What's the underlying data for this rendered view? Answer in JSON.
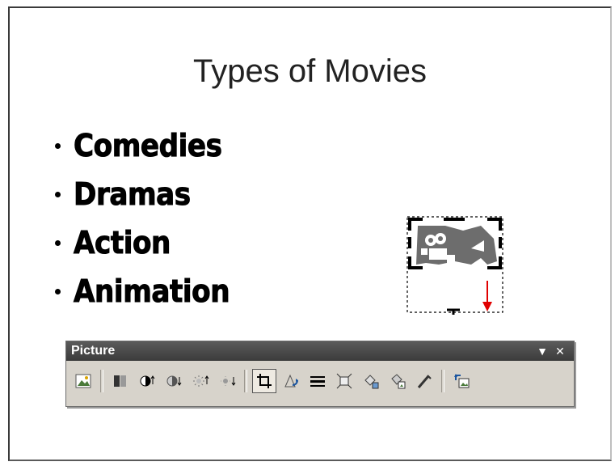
{
  "slide": {
    "title": "Types of Movies",
    "bullets": [
      "Comedies",
      "Dramas",
      "Action",
      "Animation"
    ]
  },
  "clip_art": {
    "icon": "movie-camera-clipart",
    "selected": true
  },
  "toolbar": {
    "title": "Picture",
    "menu_glyph": "▼",
    "close_glyph": "✕",
    "buttons": [
      {
        "name": "insert-picture",
        "icon": "insert-picture-icon"
      },
      {
        "name": "color",
        "icon": "color-icon"
      },
      {
        "name": "more-contrast",
        "icon": "more-contrast-icon"
      },
      {
        "name": "less-contrast",
        "icon": "less-contrast-icon"
      },
      {
        "name": "more-brightness",
        "icon": "more-brightness-icon"
      },
      {
        "name": "less-brightness",
        "icon": "less-brightness-icon"
      },
      {
        "name": "crop",
        "icon": "crop-icon",
        "pressed": true
      },
      {
        "name": "rotate-left",
        "icon": "rotate-left-icon"
      },
      {
        "name": "line-style",
        "icon": "line-style-icon"
      },
      {
        "name": "compress-pictures",
        "icon": "compress-icon"
      },
      {
        "name": "recolor-picture",
        "icon": "recolor-icon"
      },
      {
        "name": "format-picture",
        "icon": "format-picture-icon"
      },
      {
        "name": "set-transparent-color",
        "icon": "set-transparent-color-icon"
      },
      {
        "name": "reset-picture",
        "icon": "reset-picture-icon"
      }
    ]
  },
  "colors": {
    "arrow": "#e00000",
    "toolbar_title_bg": "#4a4a4a",
    "toolbar_bg": "#d7d3cb"
  }
}
